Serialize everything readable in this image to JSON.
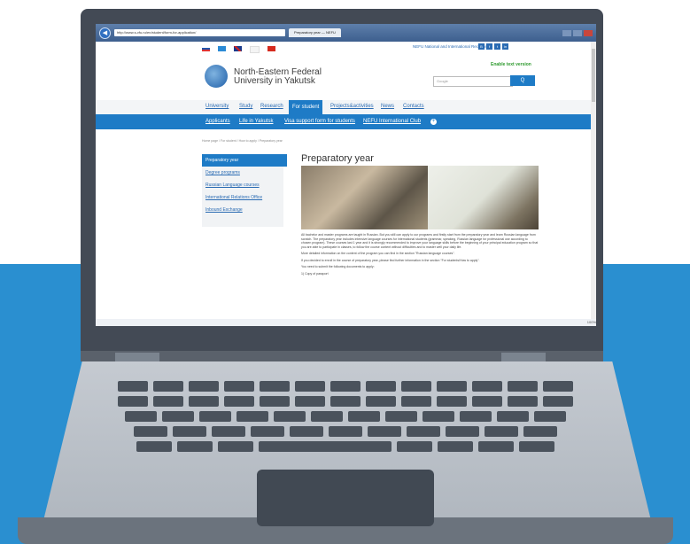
{
  "browser": {
    "address": "http://www.s-vfu.ru/en/student/form-for-application/",
    "tab_title": "Preparatory year — NEFU"
  },
  "site": {
    "top_link": "NEFU National and International Recognition",
    "enable_text": "Enable text version",
    "university_name": "North-Eastern Federal University in Yakutsk",
    "search_placeholder": "Google",
    "search_button": "Q",
    "main_nav": [
      "University",
      "Study",
      "Research",
      "For student",
      "Projects&activities",
      "News",
      "Contacts"
    ],
    "sub_nav": [
      "Applicants",
      "Life in Yakutsk",
      "Visa support form for students",
      "NEFU International Club"
    ],
    "breadcrumb": "Home page / For student / How to apply / Preparatory year",
    "sidebar": [
      "Preparatory year",
      "Degree programs",
      "Russian Language courses",
      "International Relations Office",
      "Inbound Exchange"
    ],
    "page_title": "Preparatory year",
    "paragraphs": [
      "All bachelor and master programs are taught in Russian. But you still can apply to our programs and firstly start from the preparatory year and learn Russian language from scratch. The preparatory year includes intensive language courses for international students (grammar, speaking, Russian language for professional use according to chosen program). These courses last 1 year and it is strongly recommended to improve your language skills before the beginning of your principal education program so that you are able to participate in classes, to follow the course content without difficulties and to master well your daily life.",
      "More detailed information on the content of the program you can find in the section \"Russian language courses\".",
      "If you decided to enroll in the course of preparatory year, please find further information in the section \"For students/How to apply\".",
      "",
      "You need to submit the following documents to apply:",
      "1) Copy of passport"
    ],
    "zoom": "100%"
  },
  "colors": {
    "brand_blue": "#1e7bc6",
    "background_blue": "#2a8fd0",
    "laptop_dark": "#434a55",
    "laptop_silver": "#c5cad1"
  }
}
